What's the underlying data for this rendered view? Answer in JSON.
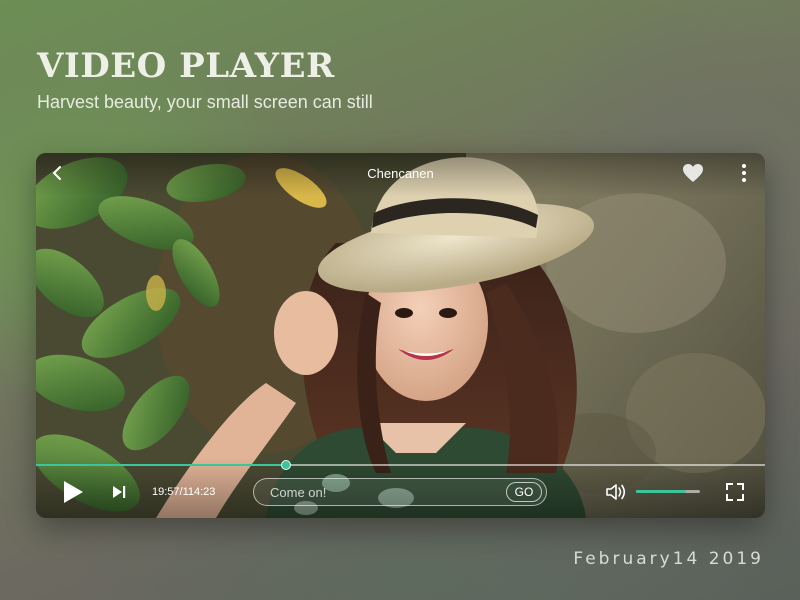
{
  "page": {
    "heading": "VIDEO PLAYER",
    "subheading": "Harvest beauty, your small screen can still",
    "date": "February14  2019"
  },
  "player": {
    "title": "Chencanen",
    "back_icon": "chevron-left-icon",
    "favorite_icon": "heart-icon",
    "more_icon": "more-vertical-icon",
    "play_icon": "play-icon",
    "next_icon": "skip-next-icon",
    "volume_icon": "volume-icon",
    "fullscreen_icon": "fullscreen-icon",
    "time": "19:57/114:23",
    "progress_fraction": 0.342,
    "volume_fraction": 0.78,
    "comment": {
      "placeholder": "Come on!",
      "value": "",
      "submit_label": "GO"
    },
    "colors": {
      "accent": "#3cc49a",
      "icon": "#ffffff"
    }
  }
}
